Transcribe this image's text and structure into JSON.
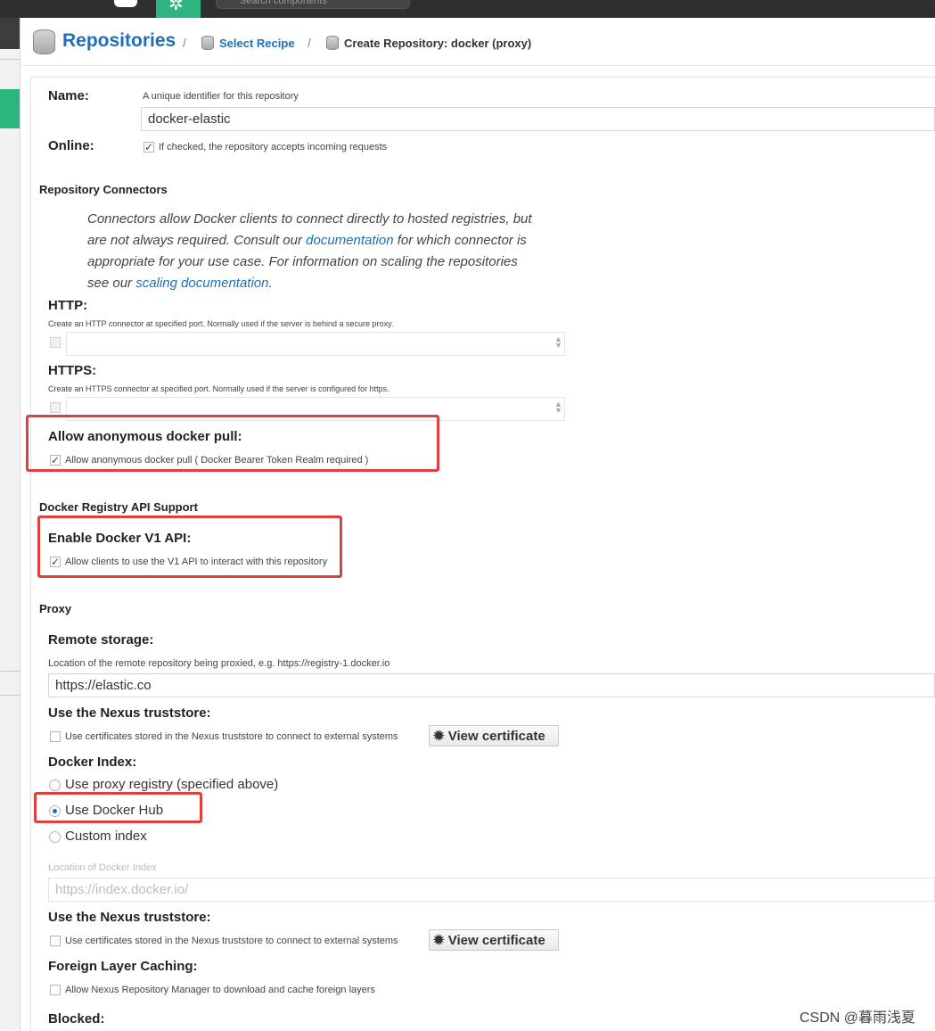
{
  "topbar": {
    "search_placeholder": "Search components"
  },
  "breadcrumb": {
    "title": "Repositories",
    "separator": "/",
    "step1": "Select Recipe",
    "current": "Create Repository: docker (proxy)"
  },
  "name_field": {
    "label": "Name:",
    "help": "A unique identifier for this repository",
    "value": "docker-elastic"
  },
  "online_field": {
    "label": "Online:",
    "help": "If checked, the repository accepts incoming requests",
    "checked": true
  },
  "connectors": {
    "section_title": "Repository Connectors",
    "description_1": "Connectors allow Docker clients to connect directly to hosted registries, but are not always required. Consult our",
    "link_1": "documentation",
    "description_2": "for which connector is appropriate for your use case. For information on scaling the repositories see our",
    "link_2": "scaling documentation",
    "description_3": ".",
    "http_label": "HTTP:",
    "http_help": "Create an HTTP connector at specified port. Normally used if the server is behind a secure proxy.",
    "https_label": "HTTPS:",
    "https_help": "Create an HTTPS connector at specified port. Normally used if the server is configured for https.",
    "anon_label": "Allow anonymous docker pull:",
    "anon_help": "Allow anonymous docker pull ( Docker Bearer Token Realm required )",
    "anon_checked": true
  },
  "api_support": {
    "section_title": "Docker Registry API Support",
    "v1_label": "Enable Docker V1 API:",
    "v1_help": "Allow clients to use the V1 API to interact with this repository",
    "v1_checked": true
  },
  "proxy": {
    "section_title": "Proxy",
    "remote_label": "Remote storage:",
    "remote_help": "Location of the remote repository being proxied, e.g. https://registry-1.docker.io",
    "remote_value": "https://elastic.co",
    "truststore_label": "Use the Nexus truststore:",
    "truststore_help": "Use certificates stored in the Nexus truststore to connect to external systems",
    "view_cert": "View certificate",
    "index_label": "Docker Index:",
    "index_options": [
      "Use proxy registry (specified above)",
      "Use Docker Hub",
      "Custom index"
    ],
    "index_selected": "Use Docker Hub",
    "index_location_help": "Location of Docker Index",
    "index_location_placeholder": "https://index.docker.io/",
    "truststore2_label": "Use the Nexus truststore:",
    "truststore2_help": "Use certificates stored in the Nexus truststore to connect to external systems",
    "view_cert2": "View certificate",
    "foreign_label": "Foreign Layer Caching:",
    "foreign_help": "Allow Nexus Repository Manager to download and cache foreign layers",
    "blocked_label": "Blocked:"
  },
  "watermark": "CSDN @暮雨浅夏",
  "highlight_color": "#e0403c",
  "link_color": "#1e6fb8"
}
